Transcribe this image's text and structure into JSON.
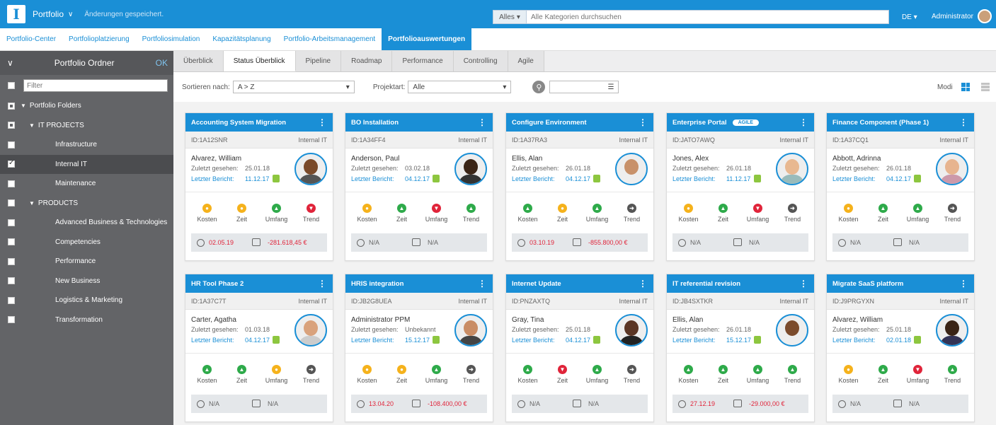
{
  "app": {
    "logo_letter": "I",
    "title": "Portfolio",
    "saved_message": "Änderungen gespeichert.",
    "search_scope": "Alles",
    "search_placeholder": "Alle Kategorien durchsuchen",
    "language": "DE",
    "user": "Administrator"
  },
  "nav": {
    "items": [
      "Portfolio-Center",
      "Portfolioplatzierung",
      "Portfoliosimulation",
      "Kapazitätsplanung",
      "Portfolio-Arbeitsmanagement",
      "Portfolioauswertungen"
    ]
  },
  "sidebar": {
    "title": "Portfolio Ordner",
    "ok": "OK",
    "filter_placeholder": "Filter",
    "tree": [
      {
        "label": "Portfolio Folders"
      },
      {
        "label": "IT PROJECTS"
      },
      {
        "label": "Infrastructure"
      },
      {
        "label": "Internal IT"
      },
      {
        "label": "Maintenance"
      },
      {
        "label": "PRODUCTS"
      },
      {
        "label": "Advanced Business & Technologies"
      },
      {
        "label": "Competencies"
      },
      {
        "label": "Performance"
      },
      {
        "label": "New Business"
      },
      {
        "label": "Logistics & Marketing"
      },
      {
        "label": "Transformation"
      }
    ]
  },
  "tabs": [
    "Überblick",
    "Status Überblick",
    "Pipeline",
    "Roadmap",
    "Performance",
    "Controlling",
    "Agile"
  ],
  "toolbar": {
    "sort_label": "Sortieren nach:",
    "sort_value": "A > Z",
    "type_label": "Projektart:",
    "type_value": "Alle",
    "mode_label": "Modi"
  },
  "labels": {
    "seen": "Zuletzt gesehen:",
    "report": "Letzter Bericht:",
    "kosten": "Kosten",
    "zeit": "Zeit",
    "umfang": "Umfang",
    "trend": "Trend"
  },
  "colors": {
    "accent": "#1a8fd6",
    "green": "#2eaa4a",
    "yellow": "#f5b21c",
    "red": "#e0243a",
    "grey": "#555555"
  },
  "cards": [
    {
      "title": "Accounting System Migration",
      "badge": "",
      "id": "ID:1A12SNR",
      "dept": "Internal IT",
      "person": "Alvarez, William",
      "seen": "25.01.18",
      "report": "11.12.17",
      "status": [
        "yellow",
        "yellow",
        "green",
        "red"
      ],
      "date": "02.05.19",
      "cost": "-281.618,45 €",
      "alert": true
    },
    {
      "title": "BO Installation",
      "badge": "",
      "id": "ID:1A34FF4",
      "dept": "Internal IT",
      "person": "Anderson, Paul",
      "seen": "03.02.18",
      "report": "04.12.17",
      "status": [
        "yellow",
        "green",
        "red",
        "green"
      ],
      "date": "N/A",
      "cost": "N/A",
      "alert": false
    },
    {
      "title": "Configure Environment",
      "badge": "",
      "id": "ID:1A37RA3",
      "dept": "Internal IT",
      "person": "Ellis, Alan",
      "seen": "26.01.18",
      "report": "04.12.17",
      "status": [
        "green",
        "yellow",
        "green",
        "grey"
      ],
      "date": "03.10.19",
      "cost": "-855.800,00 €",
      "alert": true
    },
    {
      "title": "Enterprise Portal",
      "badge": "AGILE",
      "id": "ID:JATO7AWQ",
      "dept": "Internal IT",
      "person": "Jones, Alex",
      "seen": "26.01.18",
      "report": "11.12.17",
      "status": [
        "yellow",
        "green",
        "red",
        "grey"
      ],
      "date": "N/A",
      "cost": "N/A",
      "alert": false
    },
    {
      "title": "Finance Component (Phase 1)",
      "badge": "",
      "id": "ID:1A37CQ1",
      "dept": "Internal IT",
      "person": "Abbott, Adrinna",
      "seen": "26.01.18",
      "report": "04.12.17",
      "status": [
        "yellow",
        "green",
        "green",
        "grey"
      ],
      "date": "N/A",
      "cost": "N/A",
      "alert": false
    },
    {
      "title": "HR Tool Phase 2",
      "badge": "",
      "id": "ID:1A37C7T",
      "dept": "Internal IT",
      "person": "Carter, Agatha",
      "seen": "01.03.18",
      "report": "04.12.17",
      "status": [
        "green",
        "green",
        "yellow",
        "grey"
      ],
      "date": "N/A",
      "cost": "N/A",
      "alert": false
    },
    {
      "title": "HRIS integration",
      "badge": "",
      "id": "ID:JB2G8UEA",
      "dept": "Internal IT",
      "person": "Administrator PPM",
      "seen": "Unbekannt",
      "report": "15.12.17",
      "status": [
        "yellow",
        "yellow",
        "green",
        "grey"
      ],
      "date": "13.04.20",
      "cost": "-108.400,00 €",
      "alert": true
    },
    {
      "title": "Internet Update",
      "badge": "",
      "id": "ID:PNZAXTQ",
      "dept": "Internal IT",
      "person": "Gray, Tina",
      "seen": "25.01.18",
      "report": "04.12.17",
      "status": [
        "green",
        "red",
        "green",
        "grey"
      ],
      "date": "N/A",
      "cost": "N/A",
      "alert": false
    },
    {
      "title": "IT referential revision",
      "badge": "",
      "id": "ID:JB4SXTKR",
      "dept": "Internal IT",
      "person": "Ellis, Alan",
      "seen": "26.01.18",
      "report": "15.12.17",
      "status": [
        "green",
        "green",
        "green",
        "green"
      ],
      "date": "27.12.19",
      "cost": "-29.000,00 €",
      "alert": true
    },
    {
      "title": "Migrate SaaS platform",
      "badge": "",
      "id": "ID:J9PRGYXN",
      "dept": "Internal IT",
      "person": "Alvarez, William",
      "seen": "25.01.18",
      "report": "02.01.18",
      "status": [
        "yellow",
        "green",
        "red",
        "green"
      ],
      "date": "N/A",
      "cost": "N/A",
      "alert": false
    }
  ]
}
